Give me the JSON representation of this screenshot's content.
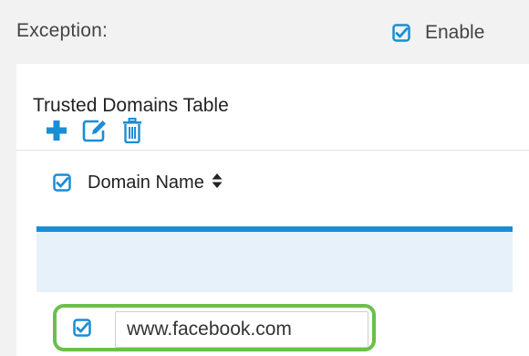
{
  "exception": {
    "label": "Exception:",
    "enable_label": "Enable",
    "enable_checked": true
  },
  "panel": {
    "title": "Trusted Domains Table"
  },
  "toolbar": {
    "icons": [
      "plus-icon",
      "edit-icon",
      "trash-icon"
    ]
  },
  "table": {
    "header": {
      "select_all_checked": true,
      "column_label": "Domain Name",
      "sort_icon": "sort-icon"
    },
    "rows": [
      {
        "checked": true,
        "domain": "www.facebook.com"
      }
    ]
  },
  "colors": {
    "accent": "#1a8ed4",
    "highlight": "#6cbf4b",
    "row_bg": "#e6f1fa",
    "page_bg": "#f2f2f2"
  }
}
